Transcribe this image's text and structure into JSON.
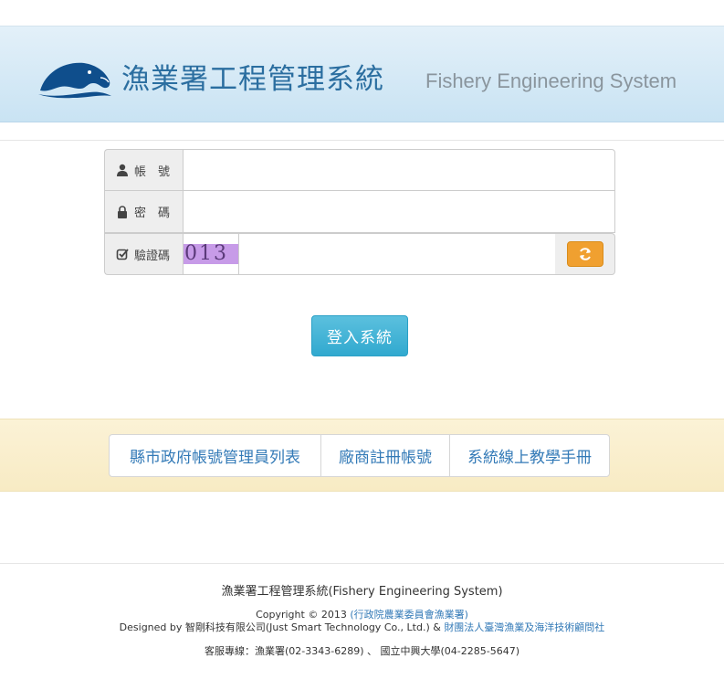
{
  "header": {
    "title_zh": "漁業署工程管理系統",
    "title_en": "Fishery Engineering System",
    "logo_icon": "dolphin-logo",
    "colors": {
      "title": "#2b6ea0",
      "subtitle": "#8a959d"
    }
  },
  "form": {
    "account_label": "帳　號",
    "account_icon": "user-icon",
    "account_value": "",
    "password_label": "密　碼",
    "password_icon": "lock-icon",
    "password_value": "",
    "captcha_label": "驗證碼",
    "captcha_icon": "check-square-icon",
    "captcha_text": "013",
    "captcha_value": "",
    "refresh_icon": "refresh-icon"
  },
  "login_button": {
    "label": "登入系統",
    "color": "#31a9cf"
  },
  "links": [
    {
      "label": "縣市政府帳號管理員列表"
    },
    {
      "label": "廠商註冊帳號"
    },
    {
      "label": "系統線上教學手冊"
    }
  ],
  "footer": {
    "title": "漁業署工程管理系統(Fishery Engineering System)",
    "copyright_prefix": "Copyright © 2013 ",
    "copyright_link": "(行政院農業委員會漁業署)",
    "designed_prefix": "Designed by 智剛科技有限公司(Just Smart Technology Co., Ltd.) & ",
    "designed_link": "財團法人臺灣漁業及海洋技術顧問社",
    "service": "客服專線：漁業署(02-3343-6289) 、 國立中興大學(04-2285-5647)"
  }
}
